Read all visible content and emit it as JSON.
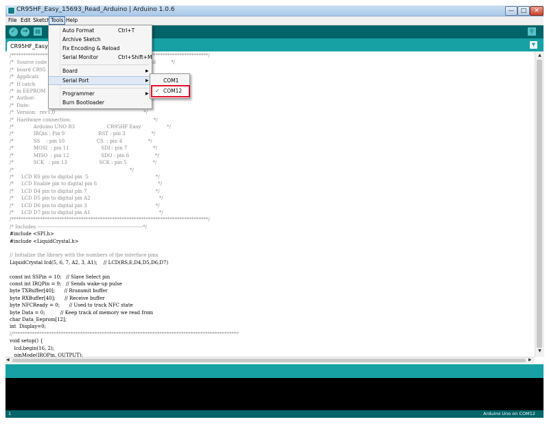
{
  "window": {
    "title": "CR95HF_Easy_15693_Read_Arduino | Arduino 1.0.6",
    "minimize": "—",
    "maximize": "□",
    "close": "✕"
  },
  "menubar": [
    "File",
    "Edit",
    "Sketch",
    "Tools",
    "Help"
  ],
  "toolbar": {
    "verify": "✓",
    "upload": "→",
    "new": "▤",
    "serial_monitor": "⚲"
  },
  "tab": {
    "name": "CR95HF_Easy_15693_Read_Arduino",
    "menu": "▼"
  },
  "tools_menu": [
    {
      "label": "Auto Format",
      "shortcut": "Ctrl+T"
    },
    {
      "label": "Archive Sketch",
      "shortcut": ""
    },
    {
      "label": "Fix Encoding & Reload",
      "shortcut": ""
    },
    {
      "label": "Serial Monitor",
      "shortcut": "Ctrl+Shift+M"
    },
    {
      "label": "Board",
      "shortcut": ""
    },
    {
      "label": "Serial Port",
      "shortcut": ""
    },
    {
      "label": "Programmer",
      "shortcut": ""
    },
    {
      "label": "Burn Bootloader",
      "shortcut": ""
    }
  ],
  "serial_ports": [
    {
      "label": "COM1",
      "checked": false
    },
    {
      "label": "COM12",
      "checked": true
    }
  ],
  "code_lines": [
    "/**********************************************************************************/",
    "/*  Source code                               ard Arduino UNO R3 and          */",
    "/*  board CR95                                                                */",
    "/*  Applicati                                                                 */",
    "/*  If catch                                  D and read data */",
    "/*  in EEPROM                                 ta on LCD.      */",
    "/*  Author:                                   N Co., Ltd                      */",
    "/*  Date:                                                                     */",
    "/*  Version:  rev1.0                                                          */",
    "/*  Hardware connection:                                                      */",
    "/*             Arduino UNO R3                     CR95HF Easy                 */",
    "/*             IRQin : Pin 9                      RST : pin 3                 */",
    "/*             SS    : pin 10                     CS  : pin 4                 */",
    "/*             MOSI  : pin 11                     SDI : pin 7                 */",
    "/*             MISO  : pin 12                     SDO : pin 6                 */",
    "/*             SCK   : pin 13                     SCK : pin 5                 */",
    "/*                                                                            */",
    "/*     LCD RS pin to digital pin  5                                            */",
    "/*     LCD Enable pin to digital pin 6                                        */",
    "/*     LCD D4 pin to digital pin 7                                             */",
    "/*     LCD D5 pin to digital pin A2                                             */",
    "/*     LCD D6 pin to digital pin 3                                             */",
    "/*     LCD D7 pin to digital pin A1                                             */",
    "/**********************************************************************************/",
    "/* Includes -----------------------------------------------------------------*/",
    "#include <SPI.h>",
    "#include <LiquidCrystal.h>",
    "",
    "// Initialize the library with the numbers of the interface pins",
    "LiquidCrystal lcd(5, 6, 7, A2, 3, A1);    // LCD(RS,E,D4,D5,D6,D7)",
    "",
    "const int SSPin = 10;   // Slave Select pin",
    "const int IRQPin = 9;   // Sends wake-up pulse",
    "byte TXBuffer[40];      // Rransmit buffer",
    "byte RXBuffer[40];      // Receive buffer",
    "byte NFCReady = 0;      // Used to track NFC state",
    "byte Data = 0;          // Keep track of memory we read from",
    "char Data_Eeprom[12];",
    "int  Display=0;",
    "//**********************************************************************************************",
    "void setup() {",
    "   lcd.begin(16, 2);",
    "   pinMode(IRQPin, OUTPUT);"
  ],
  "status": {
    "line": "1",
    "board": "Arduino Uno on COM12"
  },
  "colors": {
    "toolbar": "#006468",
    "tabbar": "#17a1a5",
    "console": "#000000",
    "highlight_border": "#e0102a"
  }
}
